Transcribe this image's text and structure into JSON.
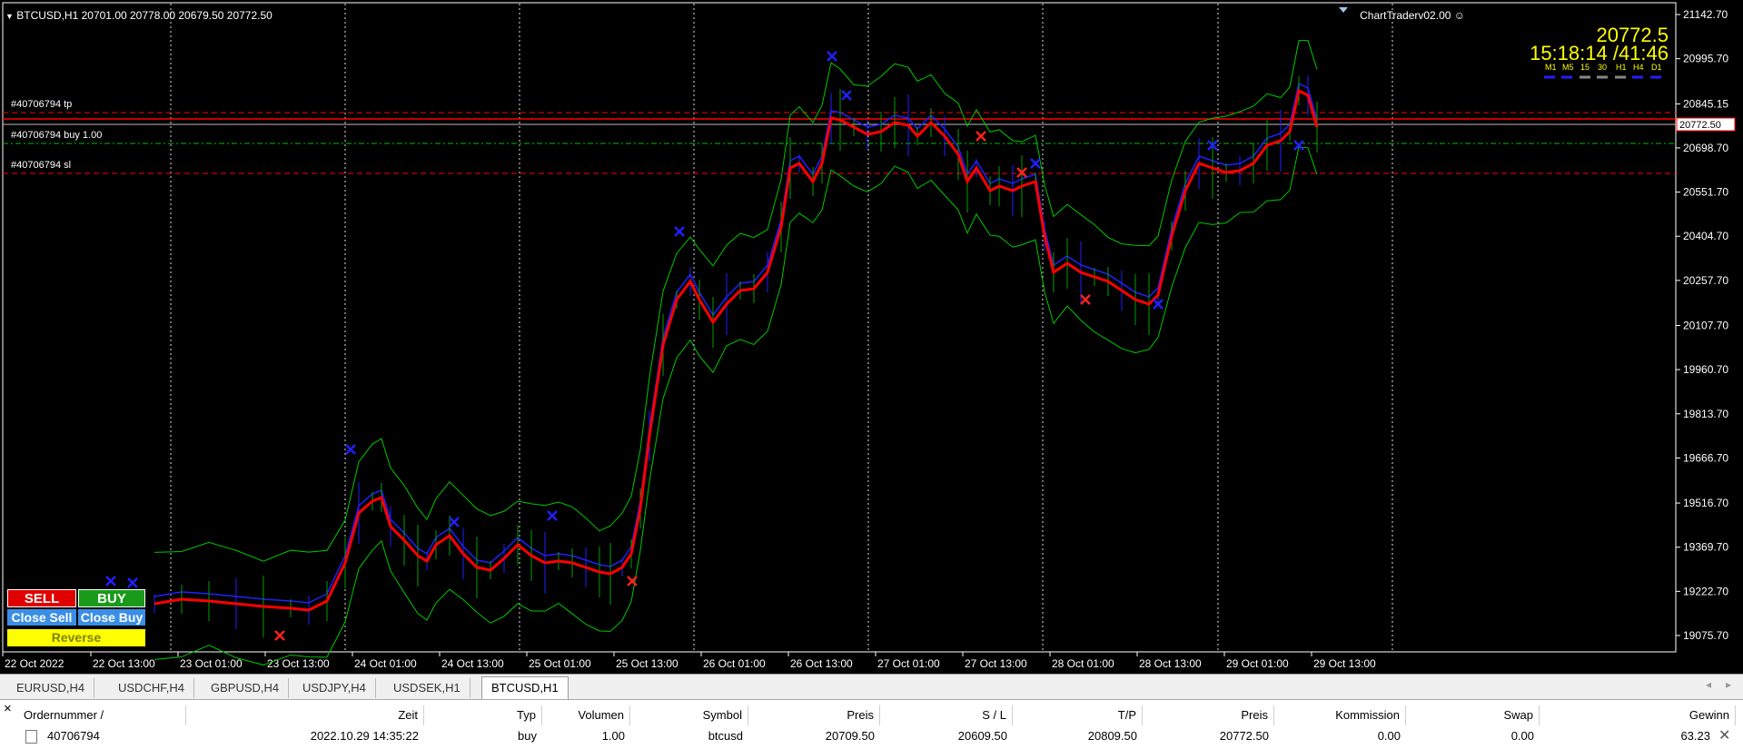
{
  "chart": {
    "header": "BTCUSD,H1  20701.00 20778.00 20679.50 20772.50",
    "ea_name": "ChartTraderv02.00 ☺",
    "big_price": "20772.5",
    "timer": "15:18:14 /41:46",
    "timeframes": [
      "M1",
      "M5",
      "15",
      "30",
      "H1",
      "H4",
      "D1"
    ],
    "price_ticks": [
      "21142.70",
      "20995.70",
      "20845.15",
      "20698.70",
      "20551.70",
      "20404.70",
      "20257.70",
      "20107.70",
      "19960.70",
      "19813.70",
      "19666.70",
      "19516.70",
      "19369.70",
      "19222.70",
      "19075.70"
    ],
    "time_ticks": [
      "22 Oct 2022",
      "22 Oct 13:00",
      "23 Oct 01:00",
      "23 Oct 13:00",
      "24 Oct 01:00",
      "24 Oct 13:00",
      "25 Oct 01:00",
      "25 Oct 13:00",
      "26 Oct 01:00",
      "26 Oct 13:00",
      "27 Oct 01:00",
      "27 Oct 13:00",
      "28 Oct 01:00",
      "28 Oct 13:00",
      "29 Oct 01:00",
      "29 Oct 13:00"
    ],
    "current_price_label": "20772.50",
    "order_lines": {
      "tp": "#40706794 tp",
      "buy": "#40706794 buy 1.00",
      "sl": "#40706794 sl"
    },
    "colors": {
      "background": "#000000",
      "ma": "#ff0000",
      "bands": "#00c800",
      "signal": "#2020ff",
      "tp_sl": "#ff0000",
      "entry": "#00c000"
    }
  },
  "buttons": {
    "sell": "SELL",
    "buy": "BUY",
    "close_sell": "Close Sell",
    "close_buy": "Close Buy",
    "reverse": "Reverse"
  },
  "tabs": [
    "EURUSD,H4",
    "USDCHF,H4",
    "GBPUSD,H4",
    "USDJPY,H4",
    "USDSEK,H1",
    "BTCUSD,H1"
  ],
  "terminal": {
    "close_icon": "×",
    "headers": [
      "Ordernummer",
      "Zeit",
      "Typ",
      "Volumen",
      "Symbol",
      "Preis",
      "S / L",
      "T/P",
      "Preis",
      "Kommission",
      "Swap",
      "Gewinn"
    ],
    "rows": [
      [
        "40706794",
        "2022.10.29 14:35:22",
        "buy",
        "1.00",
        "btcusd",
        "20709.50",
        "20609.50",
        "20809.50",
        "20772.50",
        "0.00",
        "0.00",
        "63.23"
      ]
    ]
  }
}
